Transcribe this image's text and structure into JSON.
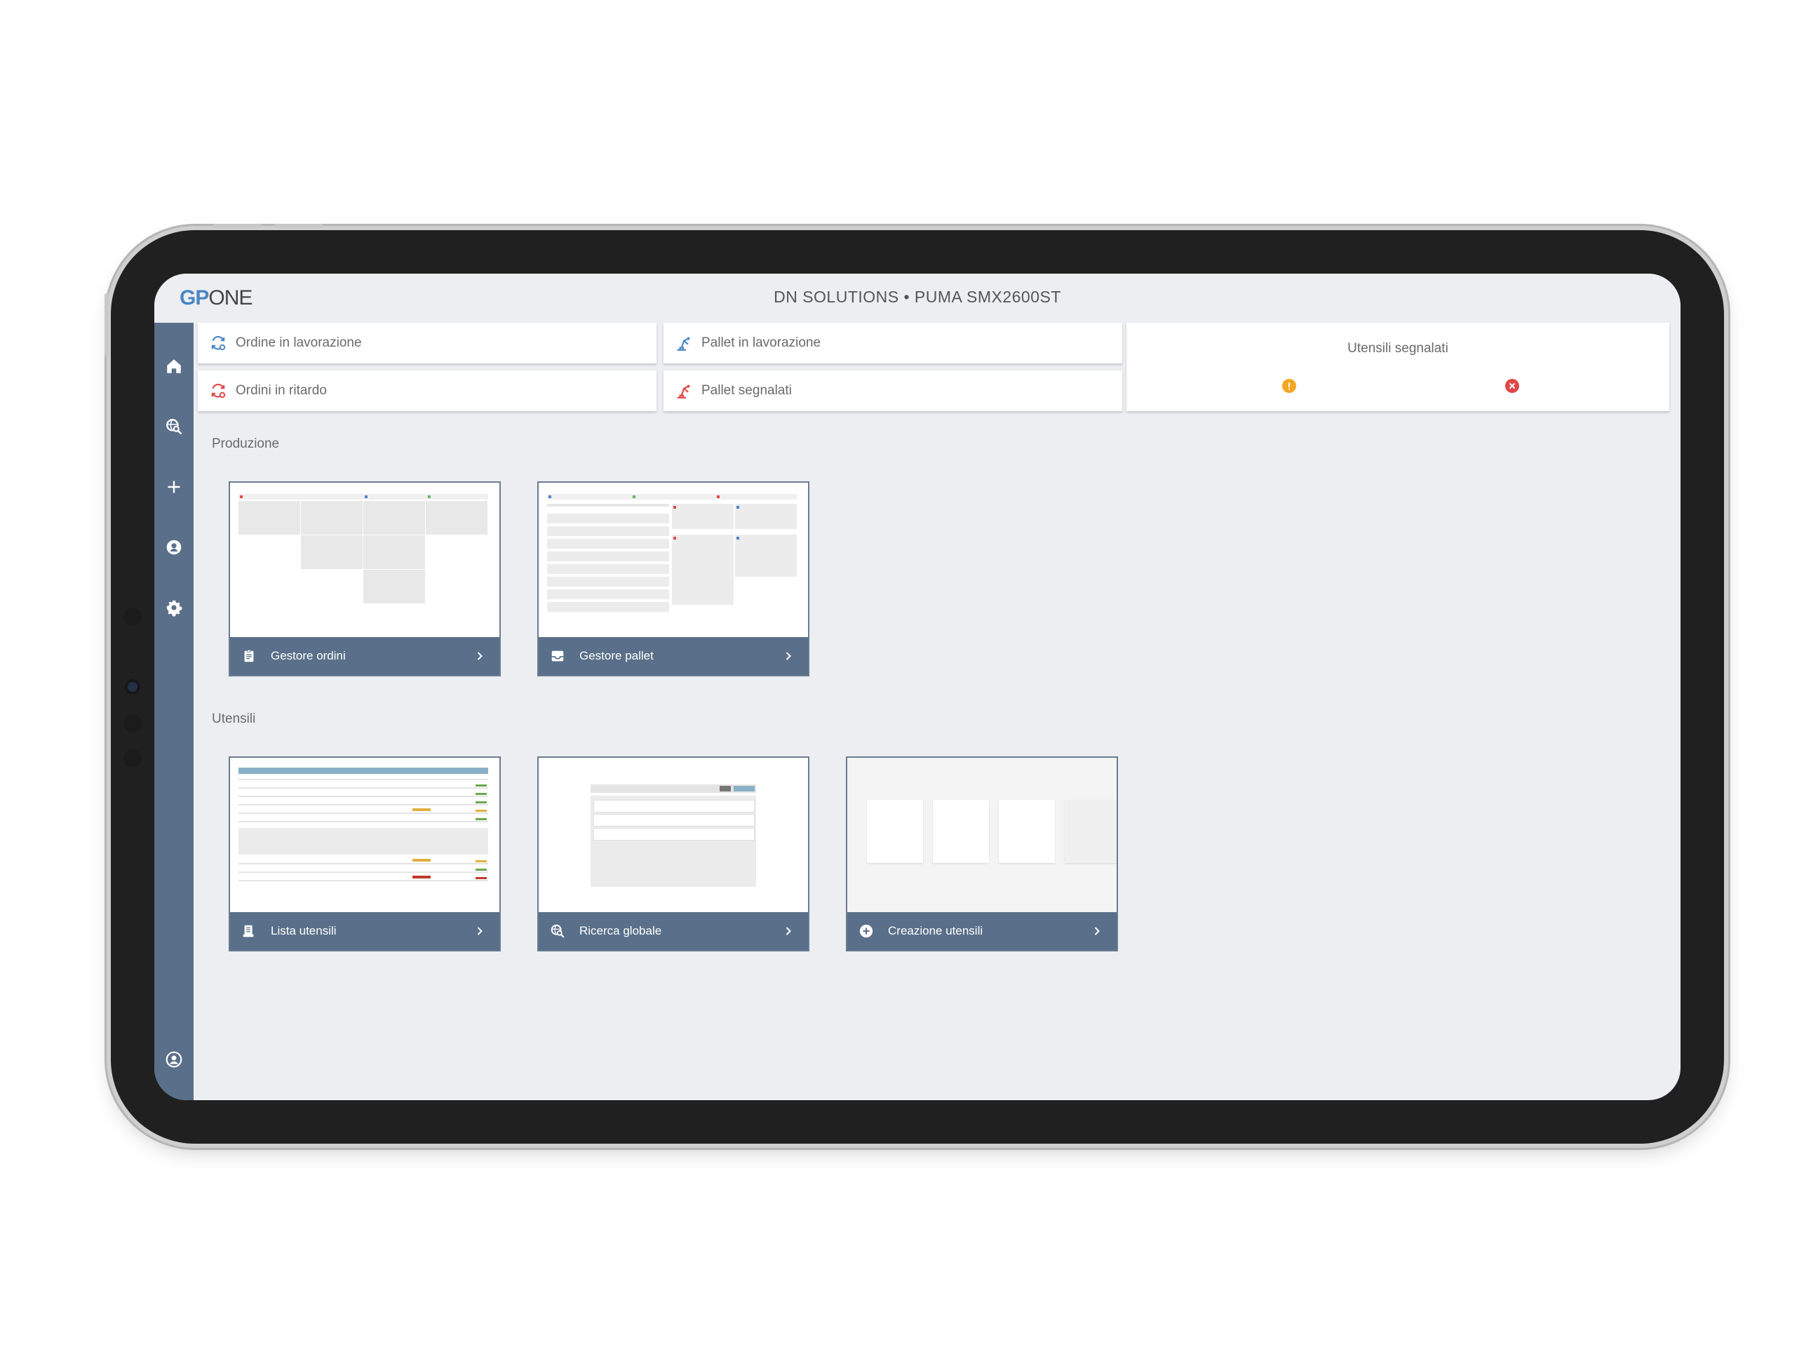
{
  "header": {
    "logo_gp": "GP",
    "logo_one": "ONE",
    "title": "DN SOLUTIONS • PUMA SMX2600ST"
  },
  "sidebar": {
    "items": [
      {
        "icon": "home-icon"
      },
      {
        "icon": "global-search-icon"
      },
      {
        "icon": "plus-icon"
      },
      {
        "icon": "badge-icon"
      },
      {
        "icon": "gear-icon"
      },
      {
        "icon": "account-circle-icon"
      }
    ]
  },
  "stats": {
    "orders_in_progress": "Ordine in lavorazione",
    "orders_late": "Ordini in ritardo",
    "pallets_in_progress": "Pallet in lavorazione",
    "pallets_flagged": "Pallet segnalati",
    "tools_flagged": "Utensili segnalati"
  },
  "colors": {
    "accent": "#4a86c5",
    "sidebar": "#5a6f89",
    "warning": "#f5a623",
    "error": "#e04848"
  },
  "sections": {
    "production": "Produzione",
    "tools": "Utensili"
  },
  "tiles": {
    "orders_manager": "Gestore ordini",
    "pallets_manager": "Gestore pallet",
    "tool_list": "Lista utensili",
    "global_search": "Ricerca globale",
    "tool_creation": "Creazione utensili"
  }
}
